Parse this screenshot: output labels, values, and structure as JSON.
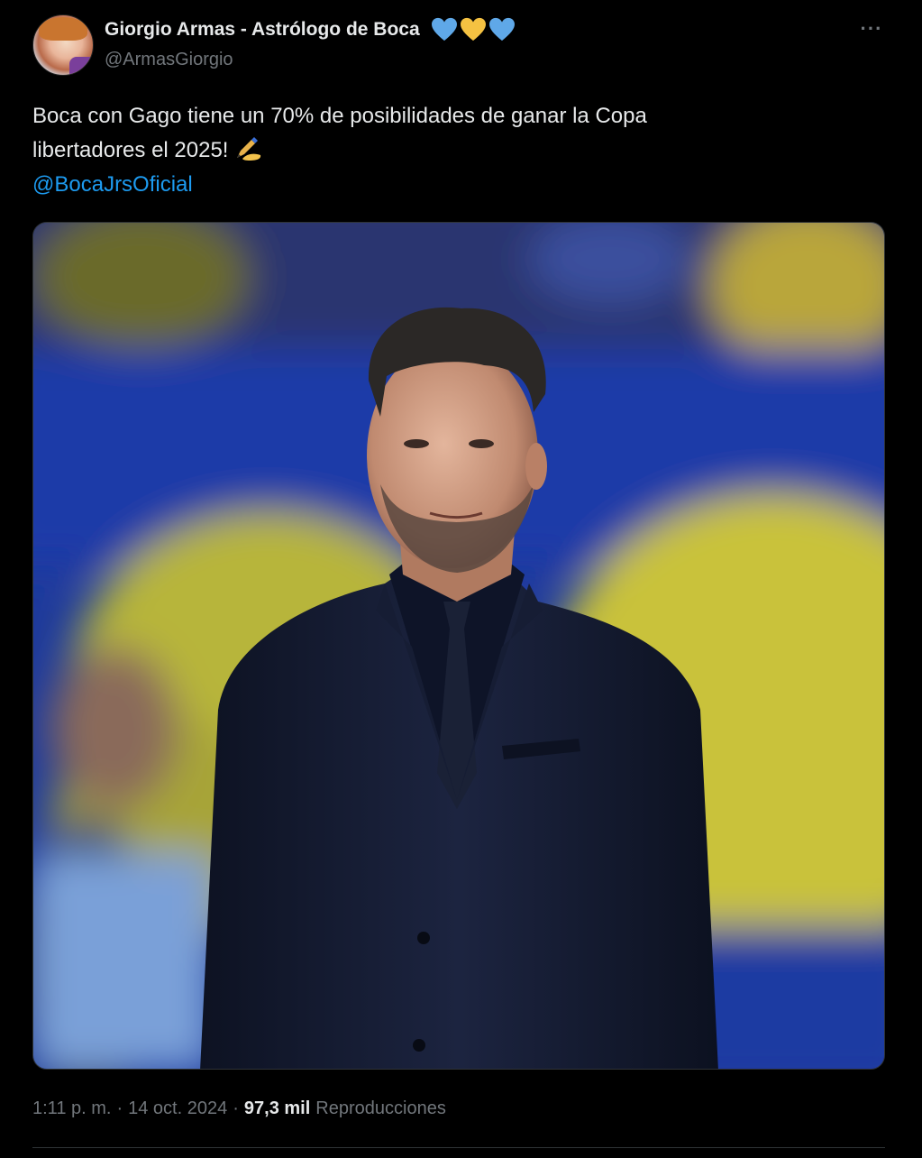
{
  "author": {
    "display_name": "Giorgio Armas - Astrólogo de Boca",
    "handle": "@ArmasGiorgio",
    "badges": [
      {
        "icon": "blue-heart-icon",
        "color": "#5fa8e8"
      },
      {
        "icon": "yellow-heart-icon",
        "color": "#f5c242"
      },
      {
        "icon": "blue-heart-icon",
        "color": "#5fa8e8"
      }
    ]
  },
  "more_menu": {
    "label": "···",
    "icon": "more-options-icon"
  },
  "tweet": {
    "line1": "Boca con Gago tiene un 70% de posibilidades de ganar la Copa",
    "line2": "libertadores el 2025!",
    "emoji_icon": "writing-hand-icon",
    "mention": "@BocaJrsOficial"
  },
  "media": {
    "icon": "photo-man-in-suit",
    "colors": {
      "background_blue": "#1e3a9c",
      "background_yellow": "#c9c23a",
      "suit": "#141a2c"
    }
  },
  "footer": {
    "time": "1:11 p. m.",
    "separator": "·",
    "date": "14 oct. 2024",
    "views_count": "97,3 mil",
    "views_label": "Reproducciones"
  },
  "colors": {
    "background": "#000000",
    "text": "#e7e9ea",
    "secondary": "#71767b",
    "link": "#1d9bf0"
  }
}
